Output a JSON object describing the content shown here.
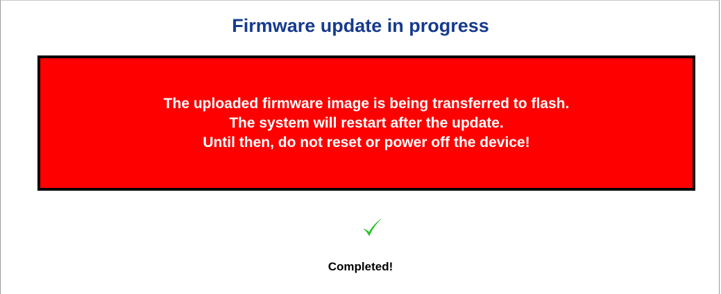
{
  "page": {
    "title": "Firmware update in progress"
  },
  "warning": {
    "lines": [
      "The uploaded firmware image is being transferred to flash.",
      "The system will restart after the update.",
      "Until then, do not reset or power off the device!"
    ],
    "background_color": "#ff0000",
    "border_color": "#000000",
    "text_color": "#ffffff"
  },
  "status": {
    "icon": "checkmark-icon",
    "icon_color": "#22cc22",
    "text": "Completed!"
  },
  "colors": {
    "title": "#163a8e"
  }
}
